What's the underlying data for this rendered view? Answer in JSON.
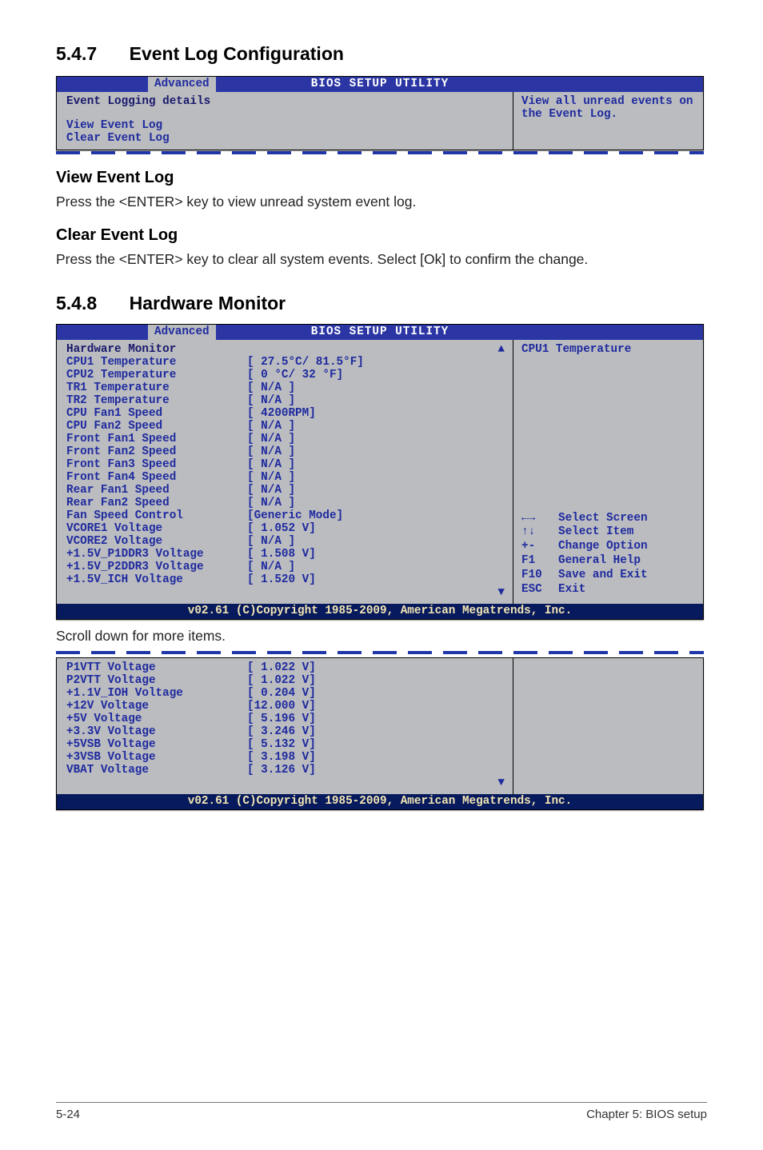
{
  "section547": {
    "num": "5.4.7",
    "title": "Event Log Configuration"
  },
  "section548": {
    "num": "5.4.8",
    "title": "Hardware Monitor"
  },
  "viewLog": {
    "head": "View Event Log",
    "text": "Press the <ENTER> key to view unread system event log."
  },
  "clearLog": {
    "head": "Clear Event Log",
    "text": "Press the <ENTER> key to clear all system events. Select [Ok] to confirm the change."
  },
  "scrollNote": "Scroll down for more items.",
  "footer": {
    "left": "5-24",
    "right": "Chapter 5: BIOS setup"
  },
  "bios_title": "BIOS SETUP UTILITY",
  "bios_tab": "Advanced",
  "bios_footer": "v02.61 (C)Copyright 1985-2009, American Megatrends, Inc.",
  "bios1": {
    "heading": "Event Logging details",
    "items": [
      "View Event Log",
      "Clear Event Log"
    ],
    "help": "View all unread events on the Event Log."
  },
  "bios2": {
    "heading": "Hardware Monitor",
    "help": "CPU1 Temperature",
    "rows": [
      {
        "lbl": "CPU1 Temperature",
        "val": "[ 27.5°C/ 81.5°F]"
      },
      {
        "lbl": "CPU2 Temperature",
        "val": "[ 0   °C/ 32   °F]"
      },
      {
        "lbl": "TR1 Temperature",
        "val": "[  N/A   ]"
      },
      {
        "lbl": "TR2 Temperature",
        "val": "[  N/A   ]"
      },
      {
        "lbl": "CPU Fan1 Speed",
        "val": "[ 4200RPM]"
      },
      {
        "lbl": "CPU Fan2 Speed",
        "val": "[  N/A   ]"
      },
      {
        "lbl": "Front Fan1 Speed",
        "val": "[  N/A   ]"
      },
      {
        "lbl": "Front Fan2 Speed",
        "val": "[  N/A   ]"
      },
      {
        "lbl": "Front Fan3 Speed",
        "val": "[  N/A   ]"
      },
      {
        "lbl": "Front Fan4 Speed",
        "val": "[  N/A   ]"
      },
      {
        "lbl": "Rear Fan1 Speed",
        "val": "[  N/A   ]"
      },
      {
        "lbl": "Rear Fan2 Speed",
        "val": "[  N/A   ]"
      },
      {
        "lbl": "Fan Speed Control",
        "val": "[Generic Mode]"
      },
      {
        "lbl": "VCORE1 Voltage",
        "val": "[ 1.052 V]"
      },
      {
        "lbl": "VCORE2 Voltage",
        "val": "[  N/A   ]"
      },
      {
        "lbl": "+1.5V_P1DDR3 Voltage",
        "val": "[ 1.508 V]"
      },
      {
        "lbl": "+1.5V_P2DDR3 Voltage",
        "val": "[  N/A   ]"
      },
      {
        "lbl": "+1.5V_ICH Voltage",
        "val": "[ 1.520 V]"
      }
    ],
    "keys": [
      {
        "k": "←→",
        "d": "Select Screen"
      },
      {
        "k": "↑↓",
        "d": "Select Item"
      },
      {
        "k": "+-",
        "d": "Change Option"
      },
      {
        "k": "F1",
        "d": "General Help"
      },
      {
        "k": "F10",
        "d": "Save and Exit"
      },
      {
        "k": "ESC",
        "d": "Exit"
      }
    ]
  },
  "bios3": {
    "rows": [
      {
        "lbl": "P1VTT Voltage",
        "val": "[ 1.022 V]"
      },
      {
        "lbl": "P2VTT Voltage",
        "val": "[ 1.022 V]"
      },
      {
        "lbl": "+1.1V_IOH Voltage",
        "val": "[ 0.204 V]"
      },
      {
        "lbl": "+12V Voltage",
        "val": "[12.000 V]"
      },
      {
        "lbl": "+5V Voltage",
        "val": "[ 5.196 V]"
      },
      {
        "lbl": "+3.3V Voltage",
        "val": "[ 3.246 V]"
      },
      {
        "lbl": "+5VSB Voltage",
        "val": "[ 5.132 V]"
      },
      {
        "lbl": "+3VSB Voltage",
        "val": "[ 3.198 V]"
      },
      {
        "lbl": "VBAT Voltage",
        "val": "[ 3.126 V]"
      }
    ]
  }
}
